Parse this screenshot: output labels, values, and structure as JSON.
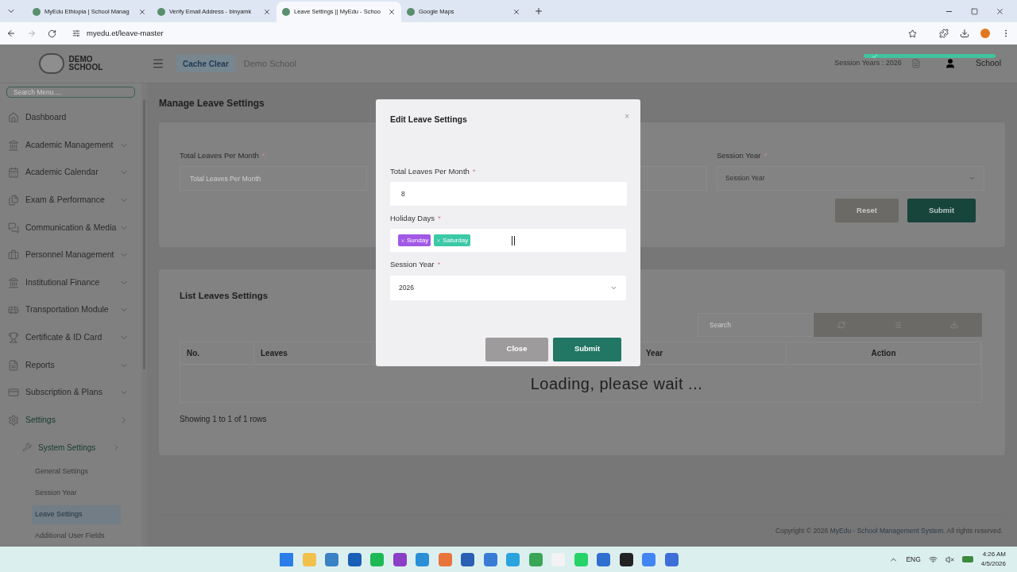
{
  "browser": {
    "tabs": [
      {
        "title": "MyEdu Ethiopia | School Manag",
        "selected": false
      },
      {
        "title": "Verify Email Address - binyamk",
        "selected": false
      },
      {
        "title": "Leave Settings || MyEdu - Schoo",
        "selected": true
      },
      {
        "title": "Google Maps",
        "selected": false
      }
    ],
    "url": "myedu.et/leave-master"
  },
  "header": {
    "logo_text": "DEMO SCHOOL",
    "cache_button": "Cache Clear",
    "school_name": "Demo School",
    "session": "Session Years : 2026",
    "user": "School"
  },
  "sidebar": {
    "search_placeholder": "Search Menu....",
    "items": [
      {
        "label": "Dashboard",
        "has_menu": false,
        "active": false
      },
      {
        "label": "Academic Management",
        "has_menu": true,
        "active": false
      },
      {
        "label": "Academic Calendar",
        "has_menu": true,
        "active": false
      },
      {
        "label": "Exam & Performance",
        "has_menu": true,
        "active": false
      },
      {
        "label": "Communication & Media",
        "has_menu": true,
        "active": false
      },
      {
        "label": "Personnel Management",
        "has_menu": true,
        "active": false
      },
      {
        "label": "Institutional Finance",
        "has_menu": true,
        "active": false
      },
      {
        "label": "Transportation Module",
        "has_menu": true,
        "active": false
      },
      {
        "label": "Certificate & ID Card",
        "has_menu": true,
        "active": false
      },
      {
        "label": "Reports",
        "has_menu": true,
        "active": false
      },
      {
        "label": "Subscription & Plans",
        "has_menu": true,
        "active": false
      },
      {
        "label": "Settings",
        "has_menu": true,
        "active": true,
        "children": [
          {
            "label": "System Settings",
            "has_menu": true,
            "active": true,
            "children": [
              {
                "label": "General Settings",
                "selected": false
              },
              {
                "label": "Session Year",
                "selected": false
              },
              {
                "label": "Leave Settings",
                "selected": true
              },
              {
                "label": "Additional User Fields",
                "selected": false
              }
            ]
          }
        ]
      }
    ]
  },
  "page": {
    "title": "Manage Leave Settings",
    "form": {
      "total_label": "Total Leaves Per Month",
      "total_mark": "*",
      "session_mark": "*",
      "total_placeholder": "Total Leaves Per Month",
      "session_label": "Session Year",
      "session_placeholder": "Session Year",
      "reset": "Reset",
      "submit": "Submit"
    },
    "list": {
      "title": "List Leaves Settings",
      "search_placeholder": "Search",
      "columns": [
        "No.",
        "Leaves",
        "Year",
        "Action"
      ],
      "loading": "Loading, please wait ...",
      "footer": "Showing 1 to 1 of 1 rows"
    },
    "copyright": {
      "prefix": "Copyright © 2026 ",
      "link": "MyEdu - School Management System",
      "suffix": ". All rights reserved."
    }
  },
  "modal": {
    "title": "Edit Leave Settings",
    "close_icon": "×",
    "total_label": "Total Leaves Per Month",
    "total_mark": "*",
    "total_value": "8",
    "holiday_label": "Holiday Days",
    "holiday_mark": "*",
    "session_mark": "*",
    "holidays": [
      {
        "label": "Sunday",
        "color": "#a259e6"
      },
      {
        "label": "Saturday",
        "color": "#3cc9a6"
      }
    ],
    "session_label": "Session Year",
    "session_value": "2026",
    "close_button": "Close",
    "submit_button": "Submit"
  },
  "taskbar": {
    "language": "ENG",
    "time": "4:26 AM",
    "date": "4/5/2026"
  }
}
